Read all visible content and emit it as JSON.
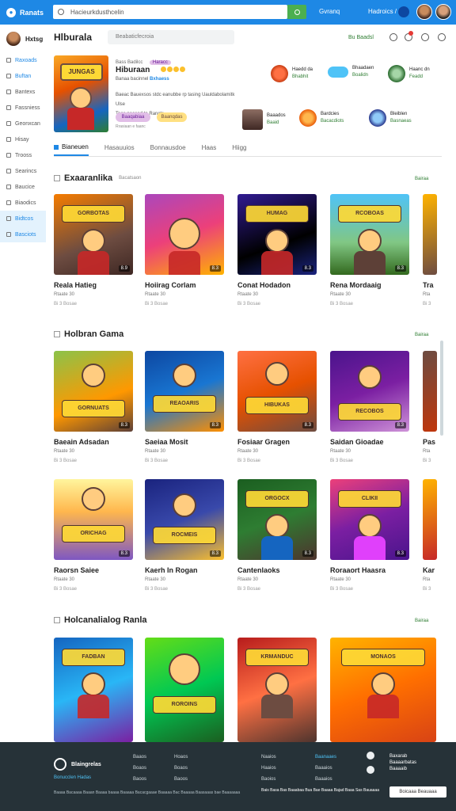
{
  "topbar": {
    "brand": "Ranats",
    "search_value": "Hacieurkdusthcelin",
    "link1": "Gvranq",
    "link2": "Hadroics / 1"
  },
  "sidebar": {
    "username": "Hxtsg",
    "items": [
      {
        "label": "Raxoads"
      },
      {
        "label": "Buftan"
      },
      {
        "label": "Bantexs"
      },
      {
        "label": "Fassniess"
      },
      {
        "label": "Geonxcan"
      },
      {
        "label": "Hisay"
      },
      {
        "label": "Trooss"
      },
      {
        "label": "Searincs"
      },
      {
        "label": "Baucice"
      },
      {
        "label": "Biaodics"
      },
      {
        "label": "Bidtcos"
      },
      {
        "label": "Basciots"
      }
    ]
  },
  "header": {
    "title": "Hlburala",
    "search_placeholder": "Beabaticfecroia",
    "status": "Bu Baadsl"
  },
  "hero": {
    "meta": "Bass Badilcc",
    "tag": "Haracc",
    "name": "Hiburaan",
    "sub_a": "Banaa bacinnel",
    "sub_b": "Bxhaess",
    "desc1": "Baeac Bauexsos stdc eanubbe rp tasing Uauldabolamitk Ulse",
    "desc2": "Teas poosod ta Rancts",
    "pill_a": "Baaqabiaa",
    "pill_b": "Baanqdas",
    "foot": "Rrasiaan e faanc"
  },
  "friends": [
    {
      "name": "Haedd da",
      "status": "Bhabhit"
    },
    {
      "name": "Bhaadaen",
      "status": "Boalidn"
    },
    {
      "name": "Haanc dn",
      "status": "Feadd"
    },
    {
      "name": "Baaados",
      "status": "Baaid"
    },
    {
      "name": "Bardcies",
      "status": "Bacacdiots"
    },
    {
      "name": "Bleiblen",
      "status": "Basnaeas"
    }
  ],
  "tabs": [
    {
      "label": "Bianeuen"
    },
    {
      "label": "Hasauuios"
    },
    {
      "label": "Bonnausdoe"
    },
    {
      "label": "Haas"
    },
    {
      "label": "Hiigg"
    }
  ],
  "sections": [
    {
      "title": "Exaaranlika",
      "subtitle": "Bacatsaon",
      "more": "Bairaa",
      "cards": [
        {
          "label": "GORBOTAS",
          "title": "Reala Hatieg",
          "meta": "Rtaate 30",
          "meta2": "Bi 3 Bosae"
        },
        {
          "label": "",
          "title": "Hoiirag Corlam",
          "meta": "Rtaate 30",
          "meta2": "Bi 3 Bosae"
        },
        {
          "label": "HUMAG",
          "title": "Conat Hodadon",
          "meta": "Rtaate 30",
          "meta2": "Bi 3 Bosae"
        },
        {
          "label": "RCOBOAS",
          "title": "Rena Mordaaig",
          "meta": "Rtaate 30",
          "meta2": "Bi 3 Bosae"
        },
        {
          "label": "",
          "title": "Tra",
          "meta": "Rta",
          "meta2": "Bi 3"
        }
      ]
    },
    {
      "title": "Holbran Gama",
      "subtitle": "",
      "more": "Bairaa",
      "cards": [
        {
          "label": "GORNUATS",
          "title": "Baeain Adsadan",
          "meta": "Rtaate 30",
          "meta2": "Bi 3 Bosae"
        },
        {
          "label": "REAOARIS",
          "title": "Saeiaa Mosit",
          "meta": "Rtaate 30",
          "meta2": "Bi 3 Bosae"
        },
        {
          "label": "HIBUKAS",
          "title": "Fosiaar Gragen",
          "meta": "Rtaate 30",
          "meta2": "Bi 3 Bosae"
        },
        {
          "label": "RECOBOS",
          "title": "Saidan Gioadae",
          "meta": "Rtaate 30",
          "meta2": "Bi 3 Bosae"
        },
        {
          "label": "",
          "title": "Pas",
          "meta": "Rta",
          "meta2": "Bi 3"
        }
      ]
    },
    {
      "title": "",
      "subtitle": "",
      "more": "",
      "cards": [
        {
          "label": "ORICHAG",
          "title": "Raorsn Saiee",
          "meta": "Rtaate 30",
          "meta2": "Bi 3 Bosae"
        },
        {
          "label": "ROCMEIS",
          "title": "Kaerh In Rogan",
          "meta": "Rtaate 30",
          "meta2": "Bi 3 Bosae"
        },
        {
          "label": "ORGOCX",
          "title": "Cantenlaoks",
          "meta": "Rtaate 30",
          "meta2": "Bi 3 Bosae"
        },
        {
          "label": "CLIKII",
          "title": "Roraaort Haasra",
          "meta": "Rtaate 30",
          "meta2": "Bi 3 Bosae"
        },
        {
          "label": "",
          "title": "Kar",
          "meta": "Rta",
          "meta2": "Bi 3"
        }
      ]
    },
    {
      "title": "Holcanalialog Ranla",
      "subtitle": "",
      "more": "Bairaa",
      "cards": [
        {
          "label": "FADBAN",
          "title": "",
          "meta": "",
          "meta2": ""
        },
        {
          "label": "ROROINS",
          "title": "",
          "meta": "",
          "meta2": ""
        },
        {
          "label": "KRMANDUC",
          "title": "",
          "meta": "",
          "meta2": ""
        },
        {
          "label": "MONAOS",
          "title": "",
          "meta": "",
          "meta2": ""
        }
      ]
    }
  ],
  "footer": {
    "logo": "Blaingrelas",
    "tagline": "Bonucclen Hadas",
    "col1": [
      "Baaos",
      "Boaos",
      "Baoos",
      "Baoos"
    ],
    "col2": [
      "Hoaos",
      "Boaos",
      "Baoos",
      "Baoos"
    ],
    "col3": [
      "Naaios",
      "Haaios",
      "Baoios"
    ],
    "col4": [
      "Baanaaes",
      "Baaaios",
      "Baaaios"
    ],
    "news": [
      "Baxarab",
      "Baaaarbatas",
      "Baaaaib"
    ],
    "copy": "Baaaa Bacaaaa Baaan Baaaa baaaa Baaaaa Bacacgaaae Baaaaa Bac Baaaaa Baasaaas bae Baaaaaaa",
    "legal": "Bais Basa Bas Baaabaa Bua Bae Baaaa Bajad Baaa Sas Bauaaaa",
    "lang_button": "Boicaaa Beauaaa"
  },
  "colors": {
    "primary": "#1e88e5",
    "accent_green": "#4caf50",
    "footer_bg": "#263238"
  }
}
